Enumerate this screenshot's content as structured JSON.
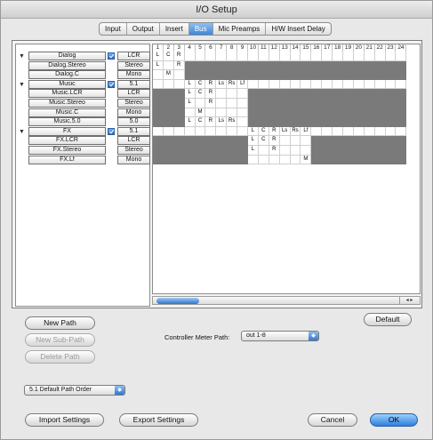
{
  "window": {
    "title": "I/O Setup"
  },
  "tabs": [
    {
      "label": "Input",
      "active": false
    },
    {
      "label": "Output",
      "active": false
    },
    {
      "label": "Insert",
      "active": false
    },
    {
      "label": "Bus",
      "active": true
    },
    {
      "label": "Mic Preamps",
      "active": false
    },
    {
      "label": "H/W Insert Delay",
      "active": false
    }
  ],
  "channel_headers": [
    "1",
    "2",
    "3",
    "4",
    "5",
    "6",
    "7",
    "8",
    "9",
    "10",
    "11",
    "12",
    "13",
    "14",
    "15",
    "16",
    "17",
    "18",
    "19",
    "20",
    "21",
    "22",
    "23",
    "24"
  ],
  "paths": [
    {
      "name": "Dialog",
      "format": "LCR",
      "main": true,
      "checked": true,
      "start": 1,
      "channels": [
        "L",
        "C",
        "R"
      ]
    },
    {
      "name": "Dialog.Stereo",
      "format": "Stereo",
      "main": false,
      "checked": false,
      "start": 1,
      "channels": [
        "L",
        "",
        "R"
      ]
    },
    {
      "name": "Dialog.C",
      "format": "Mono",
      "main": false,
      "checked": false,
      "start": 1,
      "channels": [
        "",
        "M",
        ""
      ]
    },
    {
      "name": "Music",
      "format": "5.1",
      "main": true,
      "checked": true,
      "start": 4,
      "channels": [
        "L",
        "C",
        "R",
        "Ls",
        "Rs",
        "Lf"
      ]
    },
    {
      "name": "Music.LCR",
      "format": "LCR",
      "main": false,
      "checked": false,
      "start": 4,
      "channels": [
        "L",
        "C",
        "R",
        "",
        "",
        ""
      ]
    },
    {
      "name": "Music.Stereo",
      "format": "Stereo",
      "main": false,
      "checked": false,
      "start": 4,
      "channels": [
        "L",
        "",
        "R",
        "",
        "",
        ""
      ]
    },
    {
      "name": "Music.C",
      "format": "Mono",
      "main": false,
      "checked": false,
      "start": 4,
      "channels": [
        "",
        "M",
        "",
        "",
        "",
        ""
      ]
    },
    {
      "name": "Music.5.0",
      "format": "5.0",
      "main": false,
      "checked": false,
      "start": 4,
      "channels": [
        "L",
        "C",
        "R",
        "Ls",
        "Rs",
        ""
      ]
    },
    {
      "name": "FX",
      "format": "5.1",
      "main": true,
      "checked": true,
      "start": 10,
      "channels": [
        "L",
        "C",
        "R",
        "Ls",
        "Rs",
        "Lf"
      ]
    },
    {
      "name": "FX.LCR",
      "format": "LCR",
      "main": false,
      "checked": false,
      "start": 10,
      "channels": [
        "L",
        "C",
        "R",
        "",
        "",
        ""
      ]
    },
    {
      "name": "FX.Stereo",
      "format": "Stereo",
      "main": false,
      "checked": false,
      "start": 10,
      "channels": [
        "L",
        "",
        "R",
        "",
        "",
        ""
      ]
    },
    {
      "name": "FX.Lf",
      "format": "Mono",
      "main": false,
      "checked": false,
      "start": 10,
      "channels": [
        "",
        "",
        "",
        "",
        "",
        "M"
      ]
    }
  ],
  "buttons": {
    "new_path": "New Path",
    "new_sub_path": "New Sub-Path",
    "delete_path": "Delete Path",
    "default": "Default",
    "import": "Import Settings",
    "export": "Export Settings",
    "cancel": "Cancel",
    "ok": "OK"
  },
  "controller_meter": {
    "label": "Controller Meter Path:",
    "value": "out 1-8"
  },
  "path_order": {
    "value": "5.1 Default Path Order"
  },
  "icons": {
    "expand": "disclosure-triangle-icon",
    "check": "checkbox-icon",
    "scroll": "scroll-arrows-icon",
    "popup": "popup-arrow-icon"
  },
  "colors": {
    "accent": "#3d86d8",
    "inactive_cell": "#7a7a7a"
  }
}
